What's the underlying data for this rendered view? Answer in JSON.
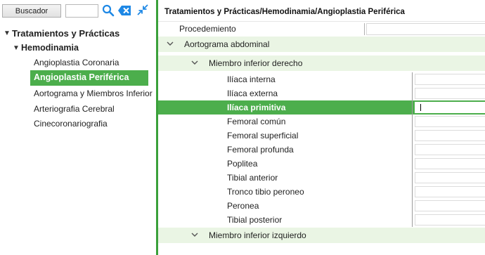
{
  "toolbar": {
    "buscador_label": "Buscador",
    "search_value": "",
    "icons": [
      "search-icon",
      "clear-icon",
      "collapse-icon"
    ]
  },
  "tree": {
    "root_label": "Tratamientos y Prácticas",
    "group_label": "Hemodinamia",
    "leaves": [
      "Angioplastia Coronaria",
      "Angioplastia Periférica",
      "Aortograma y Miembros Inferior",
      "Arteriografia Cerebral",
      "Cinecoronariografia"
    ],
    "selected_index": 1
  },
  "detail": {
    "breadcrumb": "Tratamientos y Prácticas/Hemodinamia/Angioplastia Periférica",
    "column_header": "Procedemiento",
    "section_label": "Aortograma abdominal",
    "group1_label": "Miembro inferior derecho",
    "group1_items": [
      "Ilíaca interna",
      "Ilíaca externa",
      "Ilíaca primitiva",
      "Femoral común",
      "Femoral superficial",
      "Femoral profunda",
      "Poplitea",
      "Tibial anterior",
      "Tronco tibio peroneo",
      "Peronea",
      "Tibial posterior"
    ],
    "selected_item_index": 2,
    "group2_label": "Miembro inferior izquierdo"
  },
  "colors": {
    "accent": "#4cae4c",
    "group_bg": "#eaf5e4",
    "icon_blue": "#1e88e5"
  }
}
